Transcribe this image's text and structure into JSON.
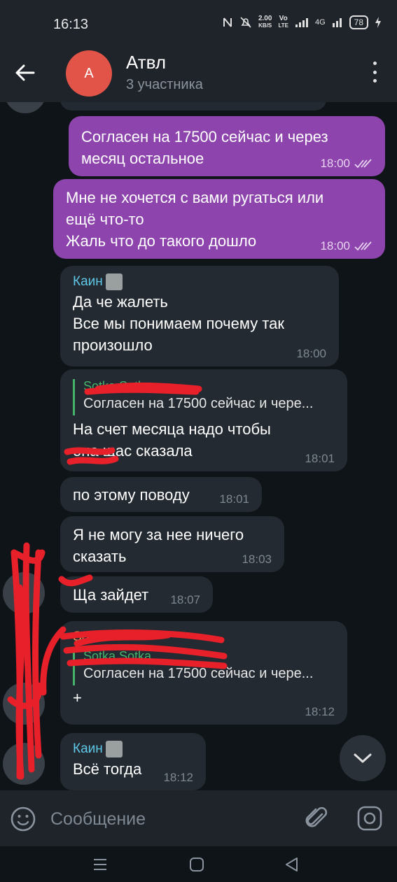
{
  "status_bar": {
    "time": "16:13",
    "net_speed_value": "2.00",
    "net_speed_unit": "KB/S",
    "volte_top": "Vo",
    "volte_bottom": "LTE",
    "network_type": "4G",
    "battery": "78"
  },
  "header": {
    "avatar_letter": "А",
    "avatar_color": "#e25448",
    "title": "Атвл",
    "subtitle": "3 участника"
  },
  "messages": [
    {
      "direction": "out",
      "text": "Согласен на 17500 сейчас и через\nмесяц остальное",
      "time": "18:00"
    },
    {
      "direction": "out",
      "text": "Мне не хочется с вами ругаться или\nещё что-то\nЖаль что до такого дошло",
      "time": "18:00"
    },
    {
      "direction": "in",
      "sender": "Каин",
      "text": "Да че жалеть\nВсе мы понимаем почему так\nпроизошло",
      "time": "18:00"
    },
    {
      "direction": "in",
      "reply_name": "Sotka Sotka",
      "reply_text": "Согласен на 17500 сейчас и чере...",
      "text": "На счет месяца надо чтобы\nона щас сказала",
      "time": "18:01"
    },
    {
      "direction": "in",
      "text": "по этому поводу",
      "time": "18:01"
    },
    {
      "direction": "in",
      "text": "Я не могу за нее ничего\nсказать",
      "time": "18:03"
    },
    {
      "direction": "in",
      "text": "Ща зайдет",
      "time": "18:07"
    },
    {
      "direction": "in",
      "sender": "Sotka",
      "reply_name": "Sotka Sotka",
      "reply_text": "Согласен на 17500 сейчас и чере...",
      "text": "+",
      "time": "18:12"
    },
    {
      "direction": "in",
      "sender": "Каин",
      "text": "Всё тогда",
      "time": "18:12"
    }
  ],
  "input": {
    "placeholder": "Сообщение"
  },
  "colors": {
    "outgoing_bubble": "#8d44ad",
    "incoming_bubble": "#232a31",
    "sender_name": "#5fc8e8",
    "reply_accent": "#45b36a",
    "scribble": "#e8202a"
  }
}
